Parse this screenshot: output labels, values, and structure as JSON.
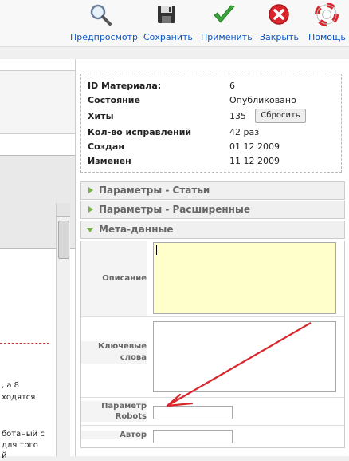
{
  "toolbar": {
    "items": [
      {
        "label": "Предпросмотр",
        "icon": "preview-magnifier-icon"
      },
      {
        "label": "Сохранить",
        "icon": "save-disk-icon"
      },
      {
        "label": "Применить",
        "icon": "apply-check-icon"
      },
      {
        "label": "Закрыть",
        "icon": "close-x-icon"
      },
      {
        "label": "Помощь",
        "icon": "help-lifebuoy-icon"
      }
    ]
  },
  "info": {
    "id_label": "ID Материала:",
    "id_value": "6",
    "state_label": "Состояние",
    "state_value": "Опубликовано",
    "hits_label": "Хиты",
    "hits_value": "135",
    "reset_label": "Сбросить",
    "revisions_label": "Кол-во исправлений",
    "revisions_value": "42 раз",
    "created_label": "Создан",
    "created_value": "01 12 2009",
    "modified_label": "Изменен",
    "modified_value": "11 12 2009"
  },
  "panels": {
    "article_params": "Параметры - Статьи",
    "advanced_params": "Параметры - Расширенные",
    "metadata": "Мета-данные"
  },
  "meta": {
    "description_label": "Описание",
    "keywords_label": "Ключевые слова",
    "robots_label": "Параметр Robots",
    "author_label": "Автор"
  },
  "left_text": {
    "line1": ", а 8",
    "line2": "ходятся",
    "line3": "ботаный с",
    "line4": "для того",
    "line5": "й"
  },
  "colors": {
    "link_blue": "#0b55c4",
    "accent_green": "#7ab24a",
    "annotation_red": "#d9252b",
    "description_bg": "#ffffcc"
  }
}
